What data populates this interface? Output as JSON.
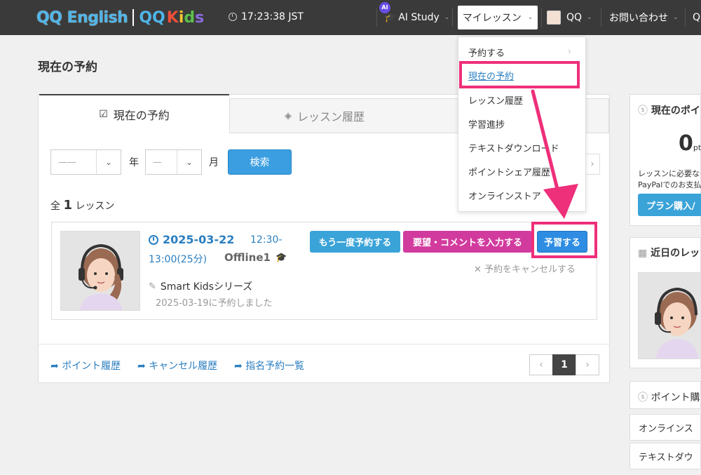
{
  "header": {
    "logo_en": "QQ English",
    "logo_qq": "QQ",
    "logo_kids": [
      "K",
      "i",
      "d",
      "s"
    ],
    "clock": "17:23:38 JST",
    "ai_badge": "AI",
    "ai_study": "AI Study",
    "my_lesson": "マイレッスン",
    "user": "QQ",
    "contact": "お問い合わせ",
    "extra": "Q"
  },
  "page": {
    "title": "現在の予約"
  },
  "tabs": [
    {
      "label": "現在の予約"
    },
    {
      "label": "レッスン履歴"
    }
  ],
  "filter": {
    "year_value": "——",
    "year_label": "年",
    "month_value": "—",
    "month_label": "月",
    "search_label": "検索"
  },
  "summary": {
    "prefix": "全",
    "count": "1",
    "suffix": "レッスン"
  },
  "reservation": {
    "date": "2025-03-22",
    "time_part1": "12:30-",
    "time_part2": "13:00(25分)",
    "teacher": "Offline1",
    "series": "Smart Kidsシリーズ",
    "booked_on": "2025-03-19に予約しました",
    "rebook_label": "もう一度予約する",
    "comment_label": "要望・コメントを入力する",
    "prepare_label": "予習する",
    "cancel_label": "予約をキャンセルする"
  },
  "footer_links": [
    "ポイント履歴",
    "キャンセル履歴",
    "指名予約一覧"
  ],
  "pagination": {
    "prev": "‹",
    "current": "1",
    "next": "›"
  },
  "dropdown": {
    "items": [
      "予約する",
      "現在の予約",
      "レッスン履歴",
      "学習進捗",
      "テキストダウンロード",
      "ポイントシェア履歴",
      "オンラインストア"
    ]
  },
  "sidebar": {
    "points_title": "現在のポイ",
    "points_value": "0",
    "points_unit": "pt",
    "note_line1": "レッスンに必要な",
    "note_line2": "PayPalでのお支払",
    "plan_button": "プラン購入/",
    "upcoming_title": "近日のレッ",
    "purchase_title": "ポイント購",
    "online_store": "オンラインス",
    "text_download": "テキストダウ"
  },
  "colors": {
    "highlight": "#ee2f7a",
    "link": "#2a7ec0",
    "primary": "#3aa3d8",
    "accent": "#d23b9e"
  }
}
